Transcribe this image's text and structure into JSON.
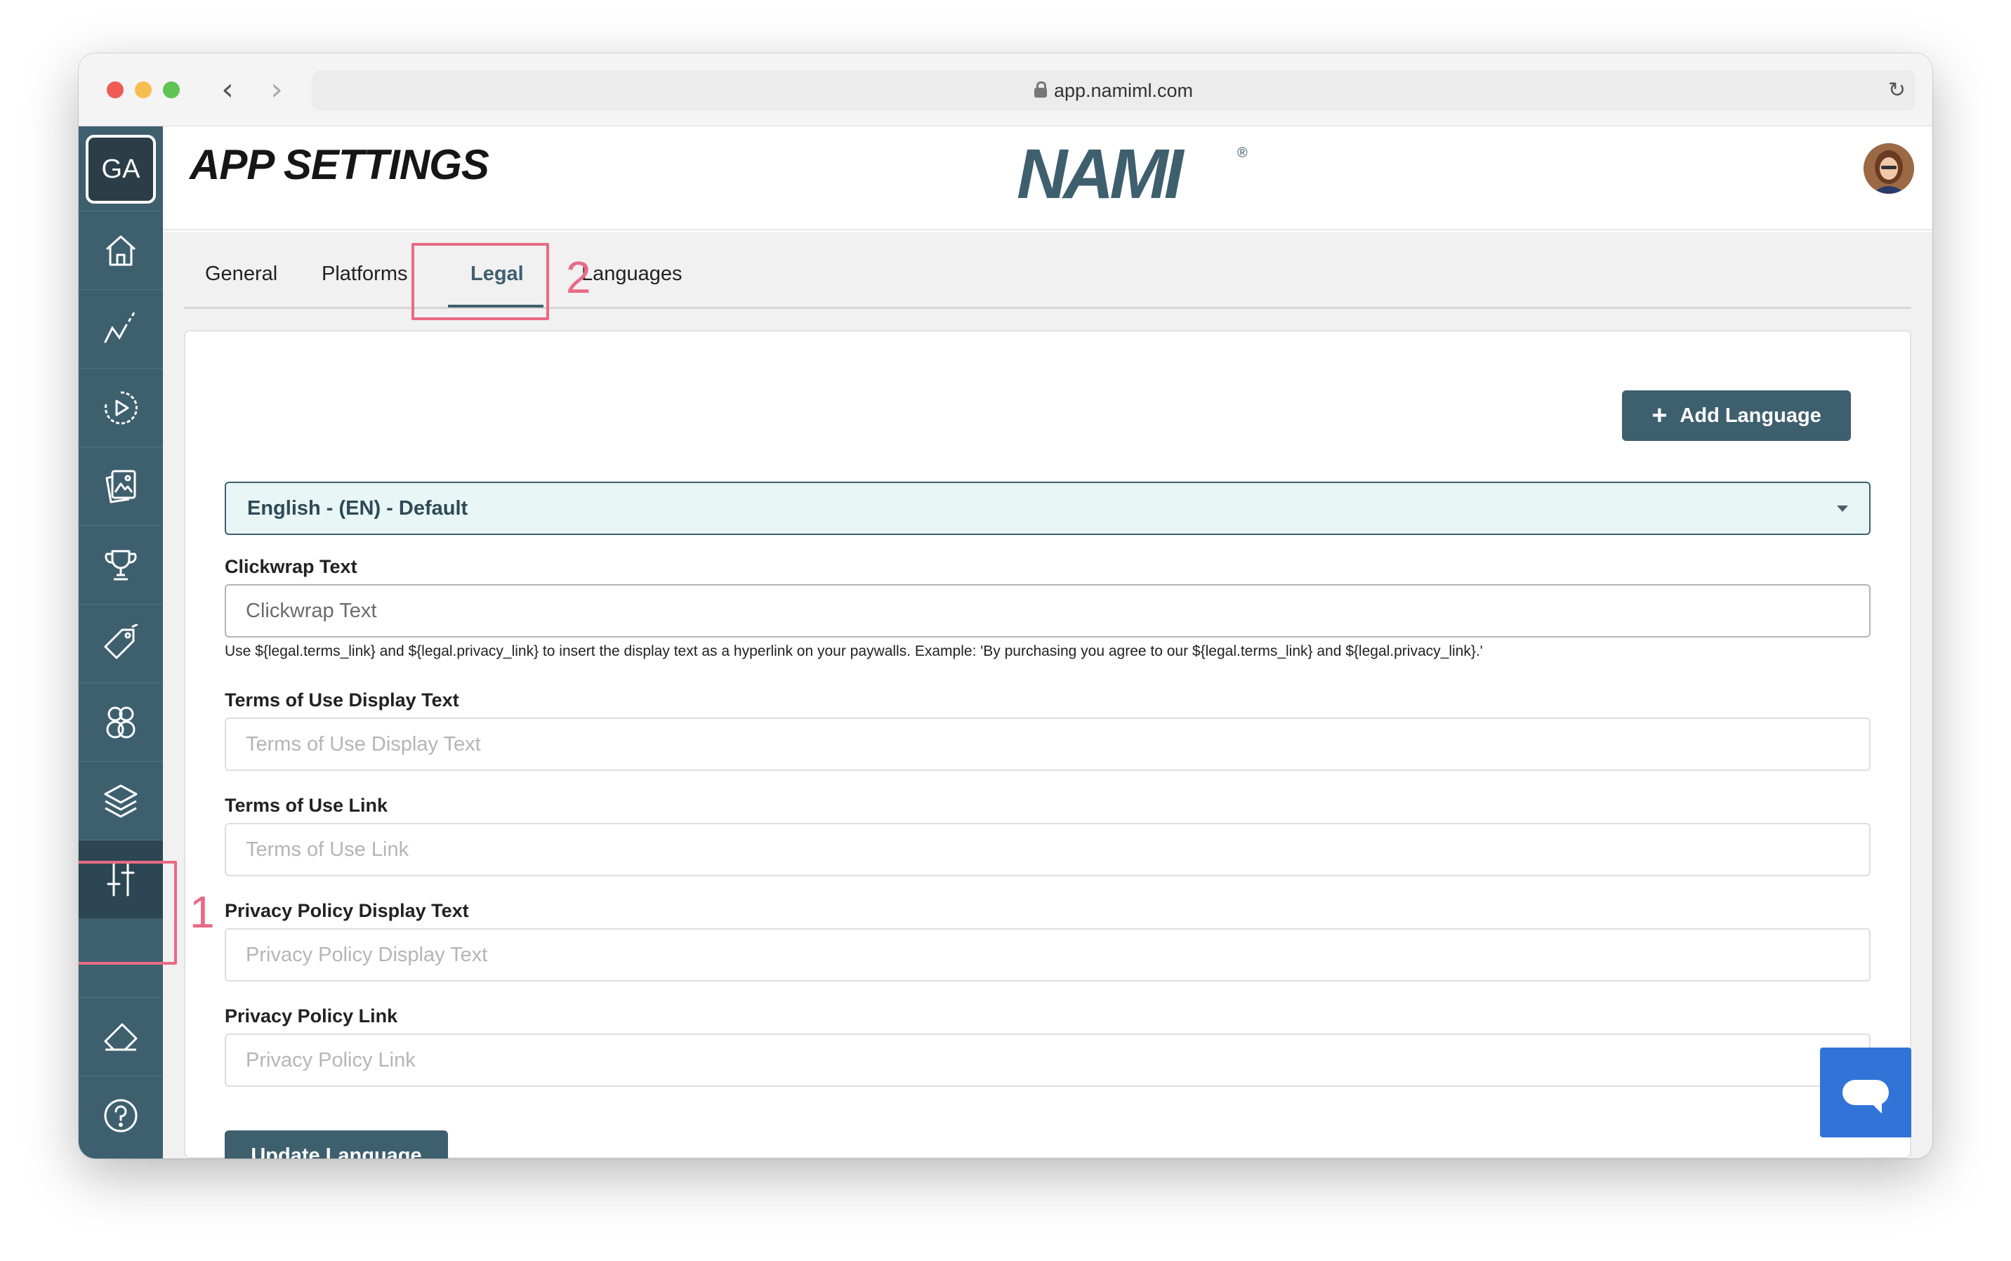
{
  "browser": {
    "url": "app.namiml.com"
  },
  "sidebar": {
    "org_initials": "GA",
    "items": [
      {
        "icon": "home-icon"
      },
      {
        "icon": "analytics-icon"
      },
      {
        "icon": "campaigns-icon"
      },
      {
        "icon": "paywalls-icon"
      },
      {
        "icon": "trophy-icon"
      },
      {
        "icon": "tag-icon"
      },
      {
        "icon": "users-icon"
      },
      {
        "icon": "layers-icon"
      },
      {
        "icon": "settings-sliders-icon"
      },
      {
        "icon": "eraser-icon"
      },
      {
        "icon": "help-icon"
      }
    ]
  },
  "header": {
    "title": "APP SETTINGS",
    "logo_text": "NAMI",
    "logo_mark": "®"
  },
  "tabs": [
    {
      "label": "General"
    },
    {
      "label": "Platforms"
    },
    {
      "label": "Legal",
      "active": true
    },
    {
      "label": "Languages"
    }
  ],
  "legal": {
    "add_language_label": "Add Language",
    "language_select_value": "English - (EN) - Default",
    "clickwrap": {
      "label": "Clickwrap Text",
      "placeholder": "Clickwrap Text",
      "hint": "Use ${legal.terms_link} and ${legal.privacy_link} to insert the display text as a hyperlink on your paywalls. Example: 'By purchasing you agree to our ${legal.terms_link} and ${legal.privacy_link}.'"
    },
    "terms_display": {
      "label": "Terms of Use Display Text",
      "placeholder": "Terms of Use Display Text"
    },
    "terms_link": {
      "label": "Terms of Use Link",
      "placeholder": "Terms of Use Link"
    },
    "privacy_display": {
      "label": "Privacy Policy Display Text",
      "placeholder": "Privacy Policy Display Text"
    },
    "privacy_link": {
      "label": "Privacy Policy Link",
      "placeholder": "Privacy Policy Link"
    },
    "update_label": "Update Language"
  },
  "annotations": {
    "step1": "1",
    "step2": "2"
  },
  "colors": {
    "brand": "#3e5f6e",
    "annotation": "#e86a86",
    "chat": "#3174d8"
  }
}
